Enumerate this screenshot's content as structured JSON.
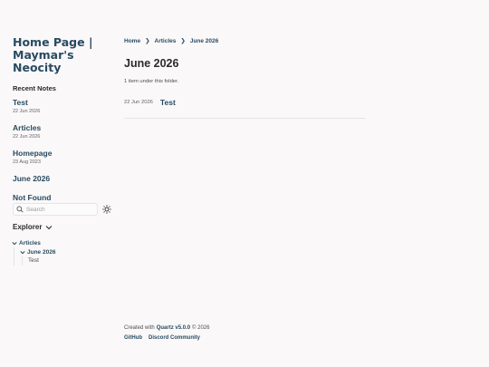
{
  "site": {
    "title": "Home Page | Maymar's Neocity"
  },
  "recent": {
    "heading": "Recent Notes",
    "items": [
      {
        "title": "Test",
        "date": "22 Jun 2026"
      },
      {
        "title": "Articles",
        "date": "22 Jun 2026"
      },
      {
        "title": "Homepage",
        "date": "23 Aug 2023"
      },
      {
        "title": "June 2026"
      },
      {
        "title": "Not Found"
      }
    ]
  },
  "search": {
    "placeholder": "Search",
    "icon": "search-icon"
  },
  "theme": {
    "icon": "sun-icon"
  },
  "explorer": {
    "title": "Explorer",
    "folder": "Articles",
    "subfolder": "June 2026",
    "file": "Test"
  },
  "breadcrumb": [
    "Home",
    "Articles",
    "June 2026"
  ],
  "breadcrumb_sep": "❯",
  "page": {
    "title": "June 2026",
    "count": "1 item under this folder.",
    "items": [
      {
        "date": "22 Jun 2026",
        "title": "Test"
      }
    ]
  },
  "footer": {
    "created_prefix": "Created with",
    "quartz": "Quartz v5.0.0",
    "copyright": "© 2026",
    "links": [
      "GitHub",
      "Discord Community"
    ]
  },
  "colors": {
    "accent": "#284b63",
    "background": "#faf8f8",
    "text": "#2b2b2b"
  }
}
